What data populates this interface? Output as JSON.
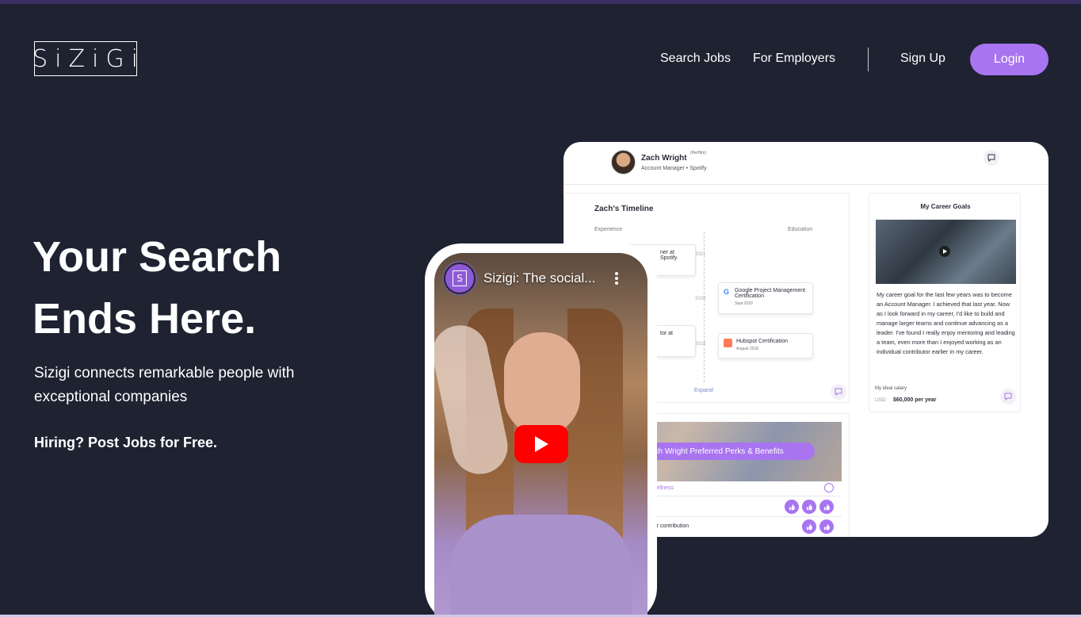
{
  "header": {
    "logo_text": "SiZiGi",
    "nav": {
      "search_jobs": "Search Jobs",
      "for_employers": "For Employers",
      "sign_up": "Sign Up",
      "login": "Login"
    }
  },
  "hero": {
    "title_line1": "Your Search",
    "title_line2": "Ends Here.",
    "subtitle": "Sizigi connects remarkable people with exceptional companies",
    "cta": "Hiring? Post Jobs for Free."
  },
  "profile_card": {
    "name": "Zach Wright",
    "pronouns": "(He/Him)",
    "role": "Account Manager • Spotify",
    "timeline": {
      "title": "Zach's Timeline",
      "col_experience": "Experience",
      "col_education": "Education",
      "years": [
        "2021",
        "2020",
        "2018"
      ],
      "exp_items": [
        {
          "title": "ner at Spotify"
        },
        {
          "title": "tor at"
        }
      ],
      "edu_items": [
        {
          "title": "Google Project Management Certification",
          "date": "Sept 2020"
        },
        {
          "title": "Hubspot Certification",
          "date": "August 2018"
        }
      ],
      "expand": "Expand"
    },
    "goals": {
      "title": "My Career Goals",
      "text": "My career goal for the last few years was to become an Account Manager. I achieved that last year. Now as I look forward in my career, I'd like to build and manage larger teams and continue advancing as a leader. I've found I really enjoy mentoring and leading a team, even more than I enjoyed working as an individual contributor earlier in my career.",
      "salary_label": "My ideal salary",
      "salary_currency": "USD",
      "salary_value": "$60,000 per year"
    },
    "perks": {
      "title": "ach Wright Preferred Perks & Benefits",
      "row1": "nd Wellness",
      "row2": "ployer contribution"
    }
  },
  "video": {
    "channel_initial": "S",
    "title": "Sizigi: The social..."
  },
  "colors": {
    "background": "#1e2231",
    "accent": "#a874f0",
    "youtube_red": "#ff0000"
  }
}
